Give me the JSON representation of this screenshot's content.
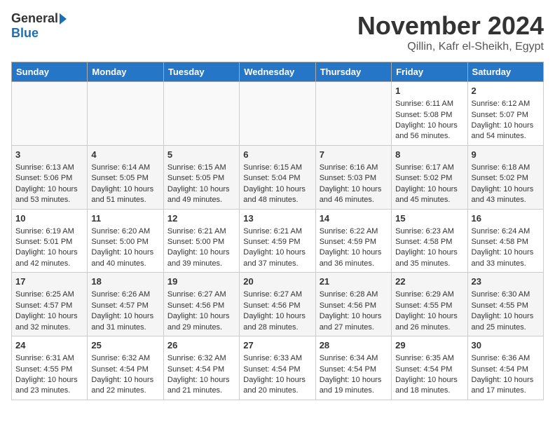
{
  "header": {
    "logo_general": "General",
    "logo_blue": "Blue",
    "month": "November 2024",
    "location": "Qillin, Kafr el-Sheikh, Egypt"
  },
  "days_of_week": [
    "Sunday",
    "Monday",
    "Tuesday",
    "Wednesday",
    "Thursday",
    "Friday",
    "Saturday"
  ],
  "weeks": [
    [
      {
        "day": "",
        "content": ""
      },
      {
        "day": "",
        "content": ""
      },
      {
        "day": "",
        "content": ""
      },
      {
        "day": "",
        "content": ""
      },
      {
        "day": "",
        "content": ""
      },
      {
        "day": "1",
        "content": "Sunrise: 6:11 AM\nSunset: 5:08 PM\nDaylight: 10 hours and 56 minutes."
      },
      {
        "day": "2",
        "content": "Sunrise: 6:12 AM\nSunset: 5:07 PM\nDaylight: 10 hours and 54 minutes."
      }
    ],
    [
      {
        "day": "3",
        "content": "Sunrise: 6:13 AM\nSunset: 5:06 PM\nDaylight: 10 hours and 53 minutes."
      },
      {
        "day": "4",
        "content": "Sunrise: 6:14 AM\nSunset: 5:05 PM\nDaylight: 10 hours and 51 minutes."
      },
      {
        "day": "5",
        "content": "Sunrise: 6:15 AM\nSunset: 5:05 PM\nDaylight: 10 hours and 49 minutes."
      },
      {
        "day": "6",
        "content": "Sunrise: 6:15 AM\nSunset: 5:04 PM\nDaylight: 10 hours and 48 minutes."
      },
      {
        "day": "7",
        "content": "Sunrise: 6:16 AM\nSunset: 5:03 PM\nDaylight: 10 hours and 46 minutes."
      },
      {
        "day": "8",
        "content": "Sunrise: 6:17 AM\nSunset: 5:02 PM\nDaylight: 10 hours and 45 minutes."
      },
      {
        "day": "9",
        "content": "Sunrise: 6:18 AM\nSunset: 5:02 PM\nDaylight: 10 hours and 43 minutes."
      }
    ],
    [
      {
        "day": "10",
        "content": "Sunrise: 6:19 AM\nSunset: 5:01 PM\nDaylight: 10 hours and 42 minutes."
      },
      {
        "day": "11",
        "content": "Sunrise: 6:20 AM\nSunset: 5:00 PM\nDaylight: 10 hours and 40 minutes."
      },
      {
        "day": "12",
        "content": "Sunrise: 6:21 AM\nSunset: 5:00 PM\nDaylight: 10 hours and 39 minutes."
      },
      {
        "day": "13",
        "content": "Sunrise: 6:21 AM\nSunset: 4:59 PM\nDaylight: 10 hours and 37 minutes."
      },
      {
        "day": "14",
        "content": "Sunrise: 6:22 AM\nSunset: 4:59 PM\nDaylight: 10 hours and 36 minutes."
      },
      {
        "day": "15",
        "content": "Sunrise: 6:23 AM\nSunset: 4:58 PM\nDaylight: 10 hours and 35 minutes."
      },
      {
        "day": "16",
        "content": "Sunrise: 6:24 AM\nSunset: 4:58 PM\nDaylight: 10 hours and 33 minutes."
      }
    ],
    [
      {
        "day": "17",
        "content": "Sunrise: 6:25 AM\nSunset: 4:57 PM\nDaylight: 10 hours and 32 minutes."
      },
      {
        "day": "18",
        "content": "Sunrise: 6:26 AM\nSunset: 4:57 PM\nDaylight: 10 hours and 31 minutes."
      },
      {
        "day": "19",
        "content": "Sunrise: 6:27 AM\nSunset: 4:56 PM\nDaylight: 10 hours and 29 minutes."
      },
      {
        "day": "20",
        "content": "Sunrise: 6:27 AM\nSunset: 4:56 PM\nDaylight: 10 hours and 28 minutes."
      },
      {
        "day": "21",
        "content": "Sunrise: 6:28 AM\nSunset: 4:56 PM\nDaylight: 10 hours and 27 minutes."
      },
      {
        "day": "22",
        "content": "Sunrise: 6:29 AM\nSunset: 4:55 PM\nDaylight: 10 hours and 26 minutes."
      },
      {
        "day": "23",
        "content": "Sunrise: 6:30 AM\nSunset: 4:55 PM\nDaylight: 10 hours and 25 minutes."
      }
    ],
    [
      {
        "day": "24",
        "content": "Sunrise: 6:31 AM\nSunset: 4:55 PM\nDaylight: 10 hours and 23 minutes."
      },
      {
        "day": "25",
        "content": "Sunrise: 6:32 AM\nSunset: 4:54 PM\nDaylight: 10 hours and 22 minutes."
      },
      {
        "day": "26",
        "content": "Sunrise: 6:32 AM\nSunset: 4:54 PM\nDaylight: 10 hours and 21 minutes."
      },
      {
        "day": "27",
        "content": "Sunrise: 6:33 AM\nSunset: 4:54 PM\nDaylight: 10 hours and 20 minutes."
      },
      {
        "day": "28",
        "content": "Sunrise: 6:34 AM\nSunset: 4:54 PM\nDaylight: 10 hours and 19 minutes."
      },
      {
        "day": "29",
        "content": "Sunrise: 6:35 AM\nSunset: 4:54 PM\nDaylight: 10 hours and 18 minutes."
      },
      {
        "day": "30",
        "content": "Sunrise: 6:36 AM\nSunset: 4:54 PM\nDaylight: 10 hours and 17 minutes."
      }
    ]
  ]
}
